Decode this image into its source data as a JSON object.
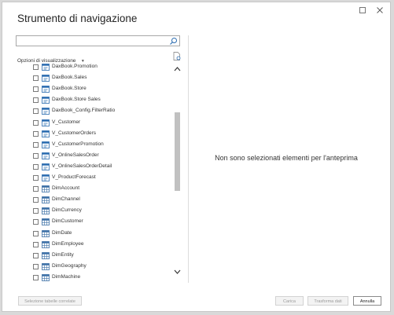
{
  "dialog": {
    "title": "Strumento di navigazione",
    "window_controls": {
      "restore_icon": "maximize-icon",
      "close_icon": "close-icon"
    }
  },
  "search": {
    "value": "",
    "placeholder": ""
  },
  "options": {
    "label": "Opzioni di visualizzazione"
  },
  "tree_items": [
    {
      "label": "DaxBook.Promotion",
      "kind": "view",
      "checked": false
    },
    {
      "label": "DaxBook.Sales",
      "kind": "view",
      "checked": false
    },
    {
      "label": "DaxBook.Store",
      "kind": "view",
      "checked": false
    },
    {
      "label": "DaxBook.Store Sales",
      "kind": "view",
      "checked": false
    },
    {
      "label": "DaxBook_Config.FilterRatio",
      "kind": "view",
      "checked": false
    },
    {
      "label": "V_Customer",
      "kind": "view",
      "checked": false
    },
    {
      "label": "V_CustomerOrders",
      "kind": "view",
      "checked": false
    },
    {
      "label": "V_CustomerPromotion",
      "kind": "view",
      "checked": false
    },
    {
      "label": "V_OnlineSalesOrder",
      "kind": "view",
      "checked": false
    },
    {
      "label": "V_OnlineSalesOrderDetail",
      "kind": "view",
      "checked": false
    },
    {
      "label": "V_ProductForecast",
      "kind": "view",
      "checked": false
    },
    {
      "label": "DimAccount",
      "kind": "table",
      "checked": false
    },
    {
      "label": "DimChannel",
      "kind": "table",
      "checked": false
    },
    {
      "label": "DimCurrency",
      "kind": "table",
      "checked": false
    },
    {
      "label": "DimCustomer",
      "kind": "table",
      "checked": false
    },
    {
      "label": "DimDate",
      "kind": "table",
      "checked": false
    },
    {
      "label": "DimEmployee",
      "kind": "table",
      "checked": false
    },
    {
      "label": "DimEntity",
      "kind": "table",
      "checked": false
    },
    {
      "label": "DimGeography",
      "kind": "table",
      "checked": false
    },
    {
      "label": "DimMachine",
      "kind": "table",
      "checked": false
    }
  ],
  "preview": {
    "message": "Non sono selezionati elementi per l'anteprima"
  },
  "footer": {
    "related_tables_label": "Selezione tabelle correlate",
    "load_label": "Carica",
    "transform_label": "Trasforma dati",
    "cancel_label": "Annulla"
  },
  "colors": {
    "view_icon": "#2b6cb0",
    "table_icon": "#3a6ea5",
    "disabled_text": "#9a9a9a"
  }
}
